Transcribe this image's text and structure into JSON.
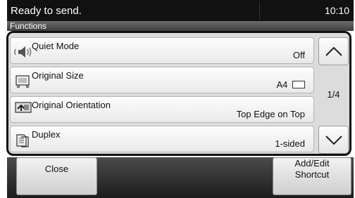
{
  "status": {
    "message": "Ready to send.",
    "time": "10:10"
  },
  "section": {
    "label": "Functions"
  },
  "items": [
    {
      "name": "Quiet Mode",
      "value": "Off",
      "icon": "speaker-icon"
    },
    {
      "name": "Original Size",
      "value": "A4",
      "icon": "original-size-icon"
    },
    {
      "name": "Original Orientation",
      "value": "Top Edge on Top",
      "icon": "orientation-icon"
    },
    {
      "name": "Duplex",
      "value": "1-sided",
      "icon": "duplex-icon"
    }
  ],
  "scroll": {
    "page": "1/4"
  },
  "bottom": {
    "close_label": "Close",
    "shortcut_line1": "Add/Edit",
    "shortcut_line2": "Shortcut"
  }
}
